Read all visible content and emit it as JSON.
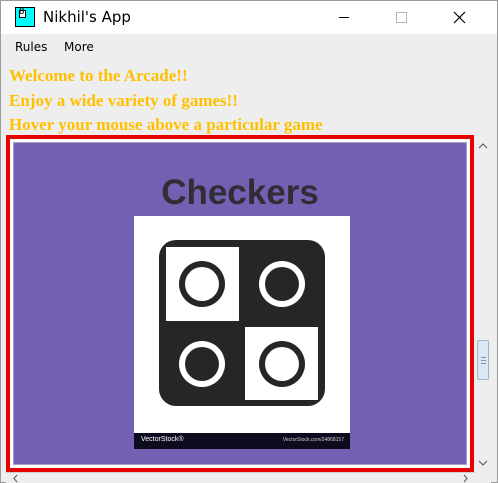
{
  "window": {
    "title": "Nikhil's App",
    "icon_label": "8",
    "icon_color": "#00ffff"
  },
  "menu": {
    "items": [
      "Rules",
      "More"
    ]
  },
  "content": {
    "messages": [
      "Welcome to the Arcade!!",
      "Enjoy a wide variety of games!!",
      "Hover your mouse above a particular game"
    ],
    "message_color": "#ffc000"
  },
  "game_card": {
    "title": "Checkers",
    "background_color": "#7360b3",
    "highlight_border_color": "#e60000",
    "image": {
      "icon": "checkers-board-icon",
      "watermark_left": "VectorStock®",
      "watermark_right": "VectorStock.com/24868157"
    }
  }
}
